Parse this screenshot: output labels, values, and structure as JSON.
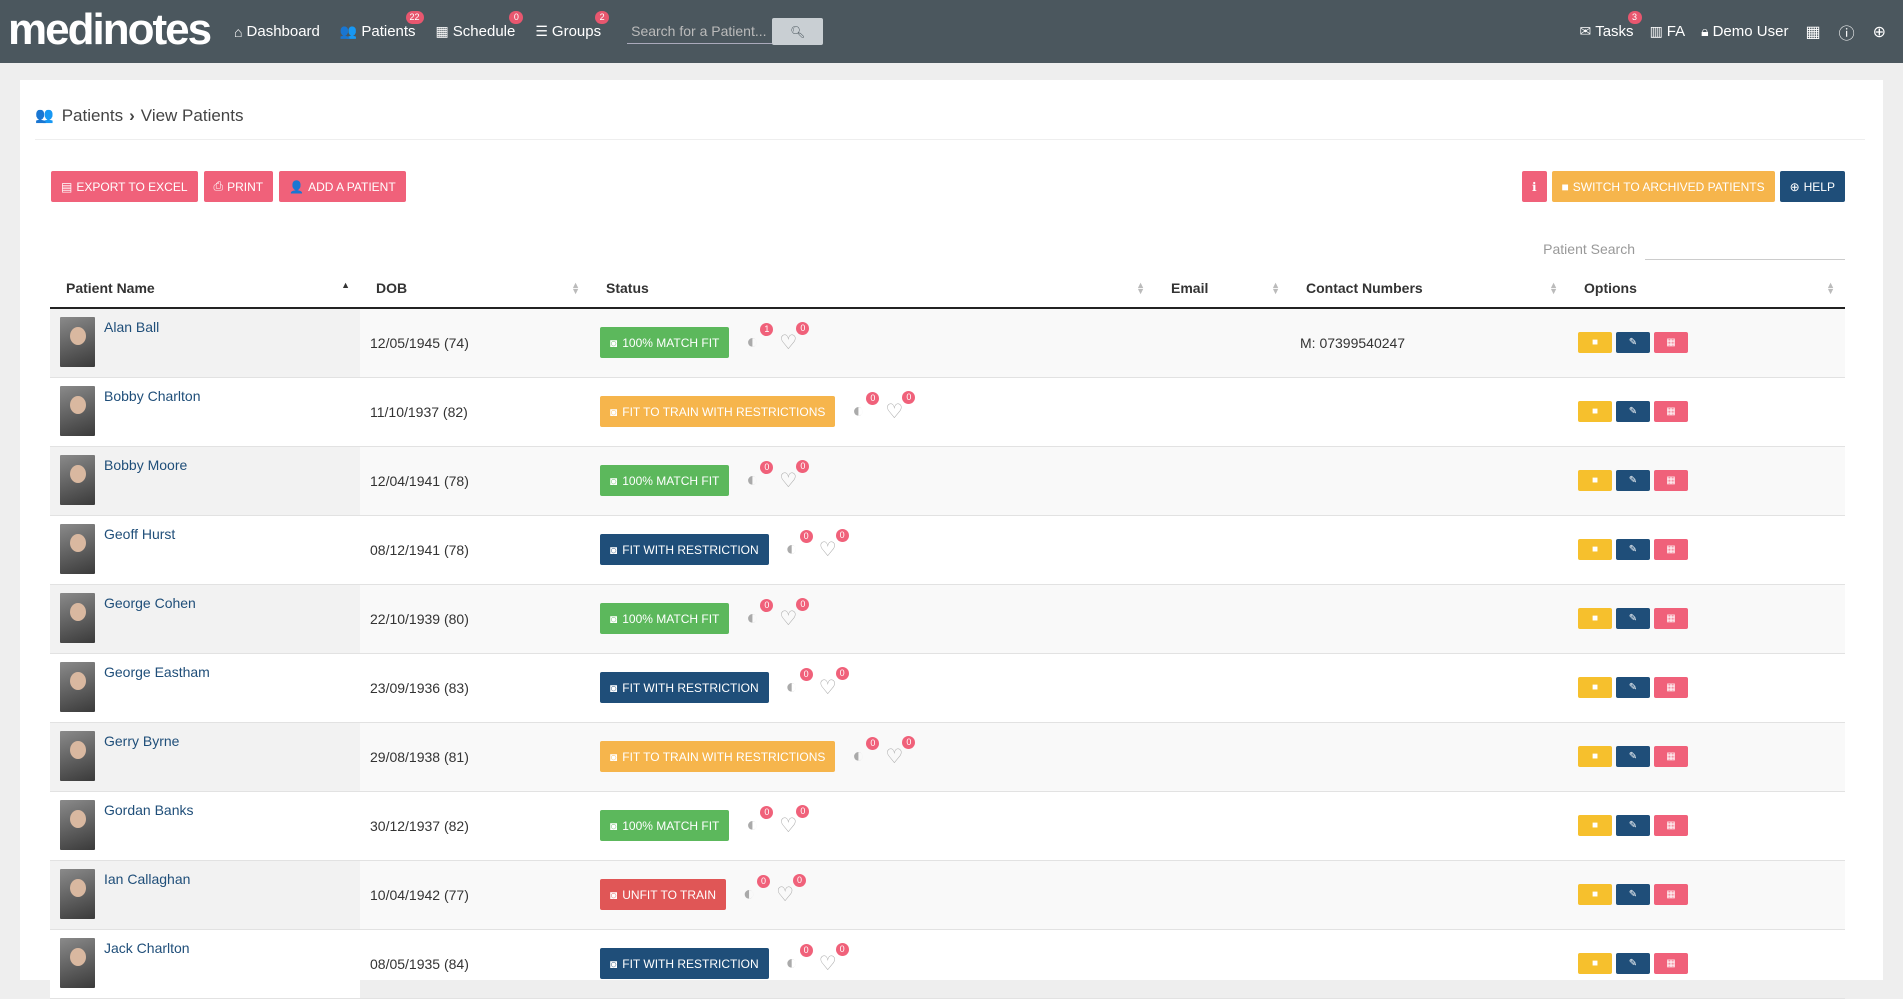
{
  "nav": {
    "brand": "medinotes",
    "items": [
      {
        "label": "Dashboard",
        "icon": "home-icon",
        "badge": ""
      },
      {
        "label": "Patients",
        "icon": "users-icon",
        "badge": "22"
      },
      {
        "label": "Schedule",
        "icon": "calendar-icon",
        "badge": "0"
      },
      {
        "label": "Groups",
        "icon": "list-icon",
        "badge": "2"
      }
    ],
    "search_placeholder": "Search for a Patient...",
    "tasks": {
      "label": "Tasks",
      "badge": "3"
    },
    "org": "FA",
    "user": "Demo User"
  },
  "breadcrumb": {
    "root": "Patients",
    "current": "View Patients"
  },
  "toolbar": {
    "export": "EXPORT TO EXCEL",
    "print": "PRINT",
    "add": "ADD A PATIENT",
    "archived": "SWITCH TO ARCHIVED PATIENTS",
    "help": "HELP"
  },
  "search": {
    "label": "Patient Search"
  },
  "columns": [
    "Patient Name",
    "DOB",
    "Status",
    "Email",
    "Contact Numbers",
    "Options"
  ],
  "patients": [
    {
      "name": "Alan Ball",
      "dob": "12/05/1945 (74)",
      "status": "100% MATCH FIT",
      "status_color": "#5cb85c",
      "a": "1",
      "b": "0",
      "contact": "M: 07399540247"
    },
    {
      "name": "Bobby Charlton",
      "dob": "11/10/1937 (82)",
      "status": "FIT TO TRAIN WITH RESTRICTIONS",
      "status_color": "#f6b54c",
      "a": "0",
      "b": "0",
      "contact": ""
    },
    {
      "name": "Bobby Moore",
      "dob": "12/04/1941 (78)",
      "status": "100% MATCH FIT",
      "status_color": "#5cb85c",
      "a": "0",
      "b": "0",
      "contact": ""
    },
    {
      "name": "Geoff Hurst",
      "dob": "08/12/1941 (78)",
      "status": "FIT WITH RESTRICTION",
      "status_color": "#1f4e79",
      "a": "0",
      "b": "0",
      "contact": ""
    },
    {
      "name": "George Cohen",
      "dob": "22/10/1939 (80)",
      "status": "100% MATCH FIT",
      "status_color": "#5cb85c",
      "a": "0",
      "b": "0",
      "contact": ""
    },
    {
      "name": "George Eastham",
      "dob": "23/09/1936 (83)",
      "status": "FIT WITH RESTRICTION",
      "status_color": "#1f4e79",
      "a": "0",
      "b": "0",
      "contact": ""
    },
    {
      "name": "Gerry Byrne",
      "dob": "29/08/1938 (81)",
      "status": "FIT TO TRAIN WITH RESTRICTIONS",
      "status_color": "#f6b54c",
      "a": "0",
      "b": "0",
      "contact": ""
    },
    {
      "name": "Gordan Banks",
      "dob": "30/12/1937 (82)",
      "status": "100% MATCH FIT",
      "status_color": "#5cb85c",
      "a": "0",
      "b": "0",
      "contact": ""
    },
    {
      "name": "Ian Callaghan",
      "dob": "10/04/1942 (77)",
      "status": "UNFIT TO TRAIN",
      "status_color": "#e05656",
      "a": "0",
      "b": "0",
      "contact": ""
    },
    {
      "name": "Jack Charlton",
      "dob": "08/05/1935 (84)",
      "status": "FIT WITH RESTRICTION",
      "status_color": "#1f4e79",
      "a": "0",
      "b": "0",
      "contact": ""
    }
  ]
}
